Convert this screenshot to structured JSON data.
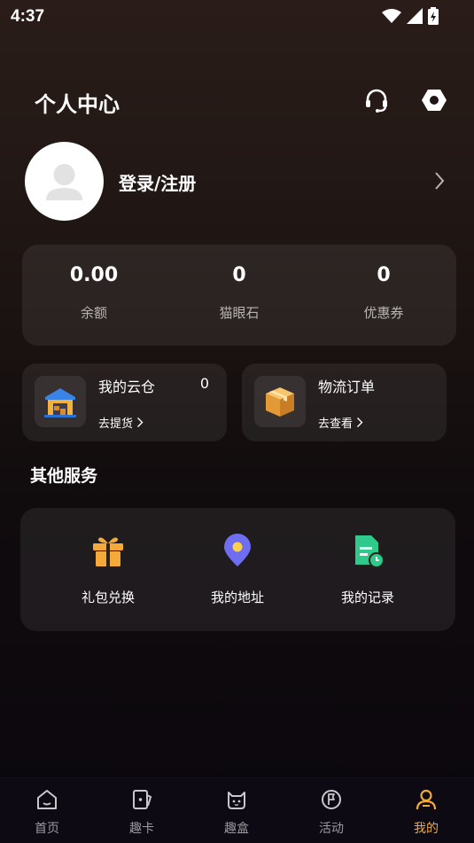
{
  "status_bar": {
    "time": "4:37"
  },
  "header": {
    "title": "个人中心"
  },
  "profile": {
    "login_label": "登录/注册"
  },
  "stats": [
    {
      "value": "0.00",
      "label": "余额"
    },
    {
      "value": "0",
      "label": "猫眼石"
    },
    {
      "value": "0",
      "label": "优惠券"
    }
  ],
  "cards": {
    "cloud": {
      "title": "我的云仓",
      "count": "0",
      "link": "去提货"
    },
    "logistics": {
      "title": "物流订单",
      "link": "去查看"
    }
  },
  "services": {
    "title": "其他服务",
    "items": [
      {
        "label": "礼包兑换",
        "icon": "gift-icon"
      },
      {
        "label": "我的地址",
        "icon": "location-pin-icon"
      },
      {
        "label": "我的记录",
        "icon": "record-icon"
      }
    ]
  },
  "tabs": [
    {
      "label": "首页",
      "icon": "home-icon"
    },
    {
      "label": "趣卡",
      "icon": "card-icon"
    },
    {
      "label": "趣盒",
      "icon": "cat-box-icon"
    },
    {
      "label": "活动",
      "icon": "activity-icon"
    },
    {
      "label": "我的",
      "icon": "profile-icon",
      "active": true
    }
  ],
  "colors": {
    "accent": "#f2a93b",
    "gift": "#f4a93a",
    "location": "#6f6ef0",
    "record": "#2fc98b"
  }
}
